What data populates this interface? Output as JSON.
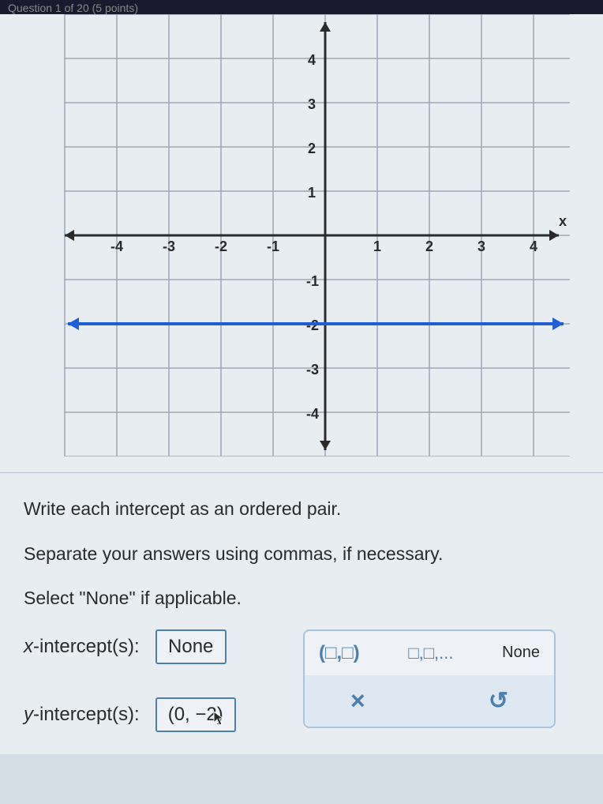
{
  "header": {
    "text": "Question 1 of 20 (5 points)"
  },
  "chart_data": {
    "type": "line",
    "title": "",
    "xlabel": "x",
    "ylabel": "",
    "xlim": [
      -5,
      5
    ],
    "ylim": [
      -5,
      5
    ],
    "x_ticks": [
      -4,
      -3,
      -2,
      -1,
      1,
      2,
      3,
      4
    ],
    "y_ticks": [
      -4,
      -3,
      -2,
      -1,
      1,
      2,
      3,
      4
    ],
    "series": [
      {
        "name": "y = -2",
        "points": [
          [
            -5,
            -2
          ],
          [
            5,
            -2
          ]
        ],
        "color": "#1e5fd8"
      }
    ]
  },
  "instructions": {
    "line1": "Write each intercept as an ordered pair.",
    "line2": "Separate your answers using commas, if necessary.",
    "line3": "Select \"None\" if applicable."
  },
  "answers": {
    "x_intercept_label": "-intercept(s):",
    "x_intercept_var": "x",
    "x_intercept_value": "None",
    "y_intercept_label": "-intercept(s):",
    "y_intercept_var": "y",
    "y_intercept_value": "(0, −2)"
  },
  "toolbar": {
    "ordered_pair": "(□,□)",
    "list": "□,□,...",
    "none": "None",
    "clear": "×",
    "undo": "↺"
  }
}
